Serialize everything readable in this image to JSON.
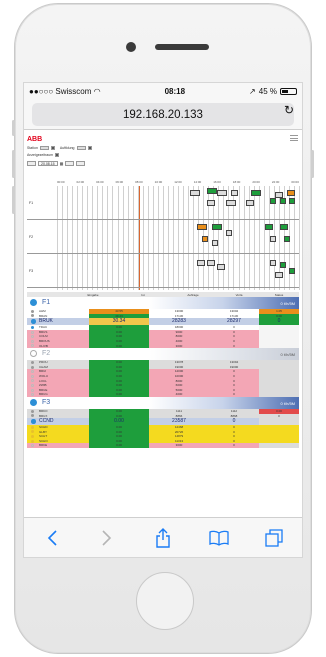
{
  "status": {
    "carrier": "●●○○○ Swisscom",
    "time": "08:18",
    "battery": "45 %"
  },
  "browser": {
    "url": "192.168.20.133"
  },
  "app": {
    "logo": "ABB",
    "controls": {
      "row1_label_a": "Station",
      "row1_label_b": "Auftklung",
      "row2_label": "Anzeigezeitraum",
      "date_value": "20.08.15"
    }
  },
  "gantt": {
    "time_ticks": [
      "00:00",
      "02:00",
      "04:00",
      "06:00",
      "08:00",
      "10:00",
      "12:00",
      "14:00",
      "16:00",
      "18:00",
      "20:00",
      "22:00",
      "00:00"
    ],
    "rows": [
      "F1",
      "F2",
      "F3"
    ],
    "colors": {
      "green": "#1e9e3c",
      "orange": "#e98f1b",
      "grey": "#dcdcdc",
      "now": "#d9662f"
    }
  },
  "table": {
    "headers": [
      "",
      "Eingabe",
      "Ist",
      "Auftrage",
      "Vorla",
      "Status"
    ],
    "groups": [
      {
        "name": "F1",
        "rate": "0 t/h/5M",
        "active": true,
        "rows": [
          {
            "name": "AHM",
            "v1": "43.55",
            "v2": "13000",
            "v3": "13002",
            "v4": "1.05",
            "dot": "grey",
            "c1": "#e98f1b",
            "c4": "#e98f1b",
            "bg": "#ffffff"
          },
          {
            "name": "BRAN",
            "v1": "49.43",
            "v2": "17130",
            "v3": "17130",
            "v4": "0.00",
            "dot": "grey",
            "c1": "#1e9e3c",
            "c4": "#1e9e3c",
            "bg": "#ffffff"
          },
          {
            "name": "BRUK",
            "v1": "30.34",
            "v2": "28283",
            "v3": "28297",
            "v4": "0",
            "dot": "blue",
            "c1": "#f2c64b",
            "c4": "#1e9e3c",
            "bg": "#c3cfe6",
            "big": true
          },
          {
            "name": "TDAC",
            "v1": "0.00",
            "v2": "18000",
            "v3": "0",
            "v4": "",
            "dot": "blue",
            "c1": "#1e9e3c",
            "c4": "#f5f5f5",
            "bg": "#ffffff"
          },
          {
            "name": "BRUS",
            "v1": "0.00",
            "v2": "9000",
            "v3": "0",
            "v4": "",
            "dot": "none",
            "c1": "#1e9e3c",
            "c4": "#f5f5f5",
            "bg": "#f3a6b5"
          },
          {
            "name": "COLM",
            "v1": "0.00",
            "v2": "8000",
            "v3": "0",
            "v4": "",
            "dot": "none",
            "c1": "#1e9e3c",
            "c4": "#f5f5f5",
            "bg": "#f3a6b5"
          },
          {
            "name": "BROUS",
            "v1": "0.00",
            "v2": "4000",
            "v3": "0",
            "v4": "",
            "dot": "none",
            "c1": "#1e9e3c",
            "c4": "#f5f5f5",
            "bg": "#f3a6b5"
          },
          {
            "name": "OLIVB",
            "v1": "0.00",
            "v2": "3000",
            "v3": "0",
            "v4": "",
            "dot": "none",
            "c1": "#1e9e3c",
            "c4": "#f5f5f5",
            "bg": "#f3a6b5"
          }
        ]
      },
      {
        "name": "F2",
        "rate": "0 t/h/5M",
        "active": false,
        "rows": [
          {
            "name": "PROU",
            "v1": "0.00",
            "v2": "13078",
            "v3": "13094",
            "v4": "",
            "dot": "grey",
            "c1": "#1e9e3c",
            "c4": "#dcdcdc",
            "bg": "#dcdcdc"
          },
          {
            "name": "CHAM",
            "v1": "0.00",
            "v2": "19000",
            "v3": "19000",
            "v4": "",
            "dot": "grey",
            "c1": "#1e9e3c",
            "c4": "#dcdcdc",
            "bg": "#dcdcdc"
          },
          {
            "name": "BRUI",
            "v1": "0.00",
            "v2": "12000",
            "v3": "0",
            "v4": "",
            "dot": "none",
            "c1": "#1e9e3c",
            "c4": "#dcdcdc",
            "bg": "#f3a6b5"
          },
          {
            "name": "WOLU",
            "v1": "0.00",
            "v2": "10000",
            "v3": "0",
            "v4": "",
            "dot": "none",
            "c1": "#1e9e3c",
            "c4": "#dcdcdc",
            "bg": "#f3a6b5"
          },
          {
            "name": "LOCL",
            "v1": "0.00",
            "v2": "8000",
            "v3": "0",
            "v4": "",
            "dot": "none",
            "c1": "#1e9e3c",
            "c4": "#dcdcdc",
            "bg": "#f3a6b5"
          },
          {
            "name": "ZWIB",
            "v1": "0.00",
            "v2": "6000",
            "v3": "0",
            "v4": "",
            "dot": "none",
            "c1": "#1e9e3c",
            "c4": "#dcdcdc",
            "bg": "#f3a6b5"
          },
          {
            "name": "BRUE",
            "v1": "0.00",
            "v2": "5000",
            "v3": "0",
            "v4": "",
            "dot": "none",
            "c1": "#1e9e3c",
            "c4": "#dcdcdc",
            "bg": "#f3a6b5"
          },
          {
            "name": "BRUG",
            "v1": "0.00",
            "v2": "4000",
            "v3": "0",
            "v4": "",
            "dot": "none",
            "c1": "#1e9e3c",
            "c4": "#dcdcdc",
            "bg": "#f3a6b5"
          }
        ]
      },
      {
        "name": "F3",
        "rate": "0 t/h/5M",
        "active": true,
        "rows": [
          {
            "name": "BRKO",
            "v1": "0.00",
            "v2": "1111",
            "v3": "1112",
            "v4": "0.00",
            "dot": "grey",
            "c1": "#1e9e3c",
            "c4": "#e24b4b",
            "bg": "#dcdcdc"
          },
          {
            "name": "BRUX",
            "v1": "0.00",
            "v2": "8866",
            "v3": "8868",
            "v4": "0",
            "dot": "grey",
            "c1": "#1e9e3c",
            "c4": "#dcdcdc",
            "bg": "#dcdcdc"
          },
          {
            "name": "CCND",
            "v1": "0.00",
            "v2": "23587",
            "v3": "0",
            "v4": "",
            "dot": "blue",
            "c1": "#1e9e3c",
            "c4": "#dcdcdc",
            "bg": "#c3cfe6",
            "big": true
          },
          {
            "name": "SCHD",
            "v1": "0.00",
            "v2": "12468",
            "v3": "0",
            "v4": "",
            "dot": "yellow",
            "c1": "#1e9e3c",
            "c4": "#f4da1f",
            "bg": "#f4da1f"
          },
          {
            "name": "GLBY",
            "v1": "0.00",
            "v2": "20726",
            "v3": "0",
            "v4": "",
            "dot": "yellow",
            "c1": "#1e9e3c",
            "c4": "#f4da1f",
            "bg": "#f4da1f"
          },
          {
            "name": "SCHT",
            "v1": "0.00",
            "v2": "14879",
            "v3": "0",
            "v4": "",
            "dot": "yellow",
            "c1": "#1e9e3c",
            "c4": "#f4da1f",
            "bg": "#f4da1f"
          },
          {
            "name": "SCHO",
            "v1": "0.00",
            "v2": "11313",
            "v3": "0",
            "v4": "",
            "dot": "yellow",
            "c1": "#1e9e3c",
            "c4": "#f4da1f",
            "bg": "#f4da1f"
          },
          {
            "name": "BRKE",
            "v1": "0.00",
            "v2": "3000",
            "v3": "0",
            "v4": "",
            "dot": "none",
            "c1": "#1e9e3c",
            "c4": "#dcdcdc",
            "bg": "#f3a6b5"
          }
        ]
      }
    ]
  },
  "toolbar": {
    "icons": [
      "back-icon",
      "forward-icon",
      "share-icon",
      "bookmarks-icon",
      "tabs-icon"
    ]
  }
}
